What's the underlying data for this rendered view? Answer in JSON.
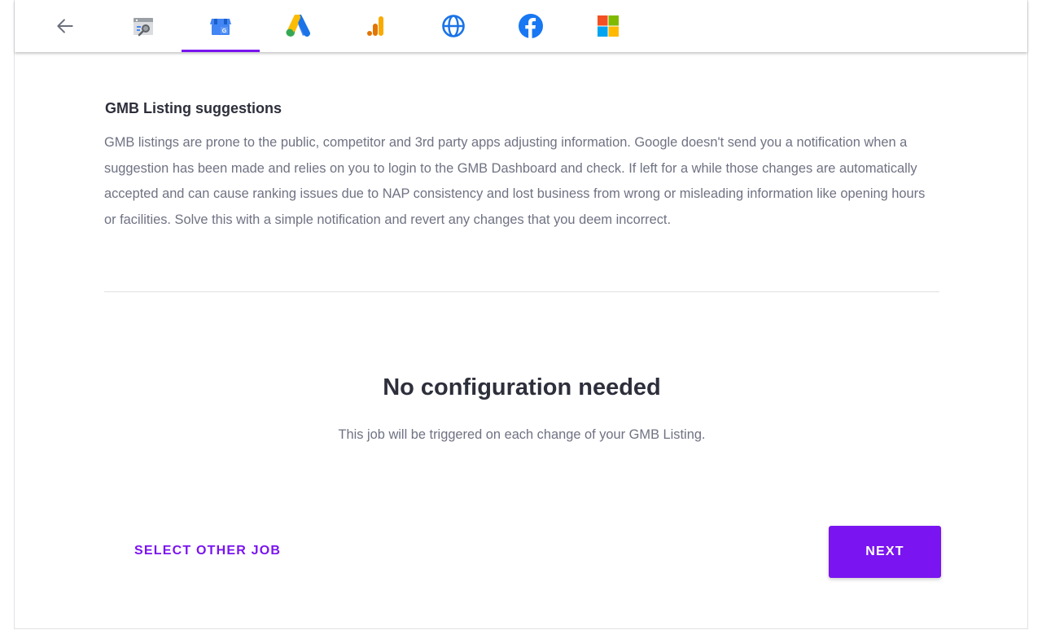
{
  "nav": {
    "back_icon": "arrow-left-icon",
    "tabs": [
      {
        "icon": "search-console-icon",
        "active": false
      },
      {
        "icon": "google-my-business-icon",
        "active": true
      },
      {
        "icon": "google-ads-icon",
        "active": false
      },
      {
        "icon": "google-analytics-icon",
        "active": false
      },
      {
        "icon": "globe-icon",
        "active": false
      },
      {
        "icon": "facebook-icon",
        "active": false
      },
      {
        "icon": "microsoft-icon",
        "active": false
      }
    ],
    "accent_color": "#7a14f0"
  },
  "job": {
    "title": "GMB Listing suggestions",
    "description": "GMB listings are prone to the public, competitor and 3rd party apps adjusting information. Google doesn't send you a notification when a suggestion has been made and relies on you to login to the GMB Dashboard and check. If left for a while those changes are automatically accepted and can cause ranking issues due to NAP consistency and lost business from wrong or misleading information like opening hours or facilities. Solve this with a simple notification and revert any changes that you deem incorrect."
  },
  "config": {
    "heading": "No configuration needed",
    "subtext": "This job will be triggered on each change of your GMB Listing."
  },
  "actions": {
    "select_other_label": "SELECT OTHER JOB",
    "next_label": "NEXT"
  }
}
